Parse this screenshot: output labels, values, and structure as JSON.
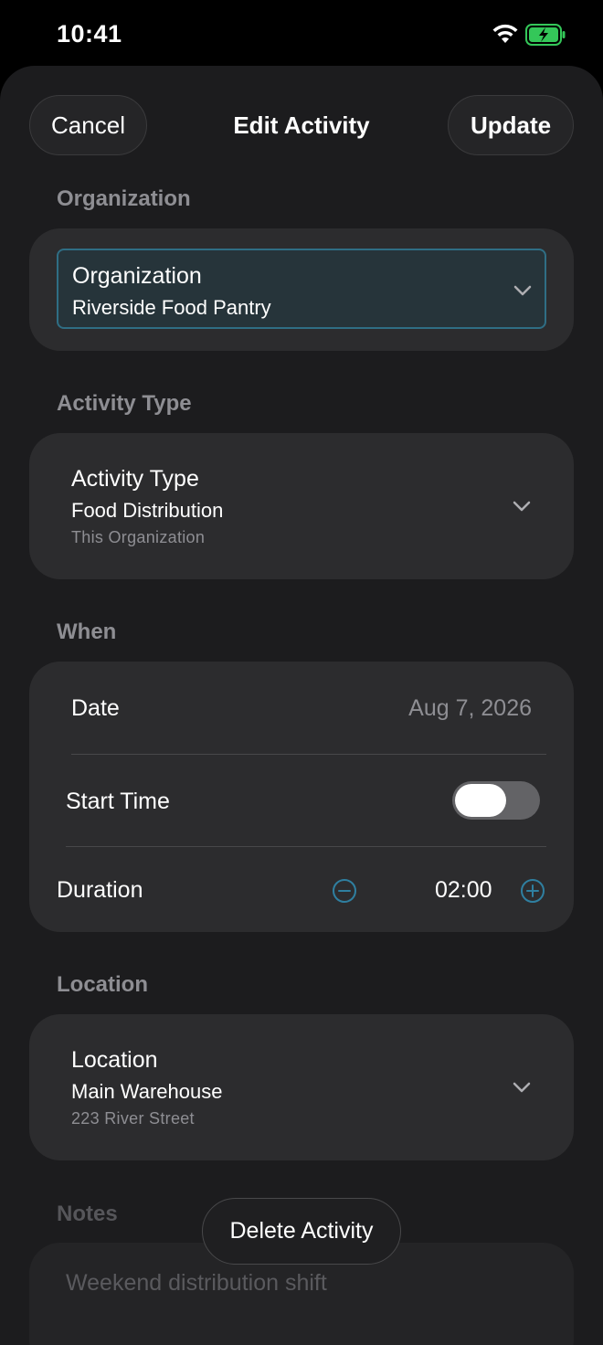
{
  "status_bar": {
    "time": "10:41"
  },
  "nav": {
    "cancel_label": "Cancel",
    "title": "Edit Activity",
    "update_label": "Update"
  },
  "organization": {
    "section_title": "Organization",
    "field_label": "Organization",
    "value": "Riverside Food Pantry"
  },
  "activity_type": {
    "section_title": "Activity Type",
    "field_label": "Activity Type",
    "value": "Food Distribution",
    "scope": "This Organization"
  },
  "when": {
    "section_title": "When",
    "date_label": "Date",
    "date_value": "Aug 7, 2026",
    "start_time_label": "Start Time",
    "start_time_enabled": false,
    "duration_label": "Duration",
    "duration_value": "02:00"
  },
  "location": {
    "section_title": "Location",
    "field_label": "Location",
    "value": "Main Warehouse",
    "address": "223 River Street"
  },
  "notes": {
    "section_title": "Notes",
    "placeholder": "Weekend distribution shift"
  },
  "actions": {
    "delete_label": "Delete Activity"
  },
  "colors": {
    "accent": "#2f7fa0",
    "background": "#1c1c1e",
    "card": "#2c2c2e",
    "battery": "#34c759"
  }
}
